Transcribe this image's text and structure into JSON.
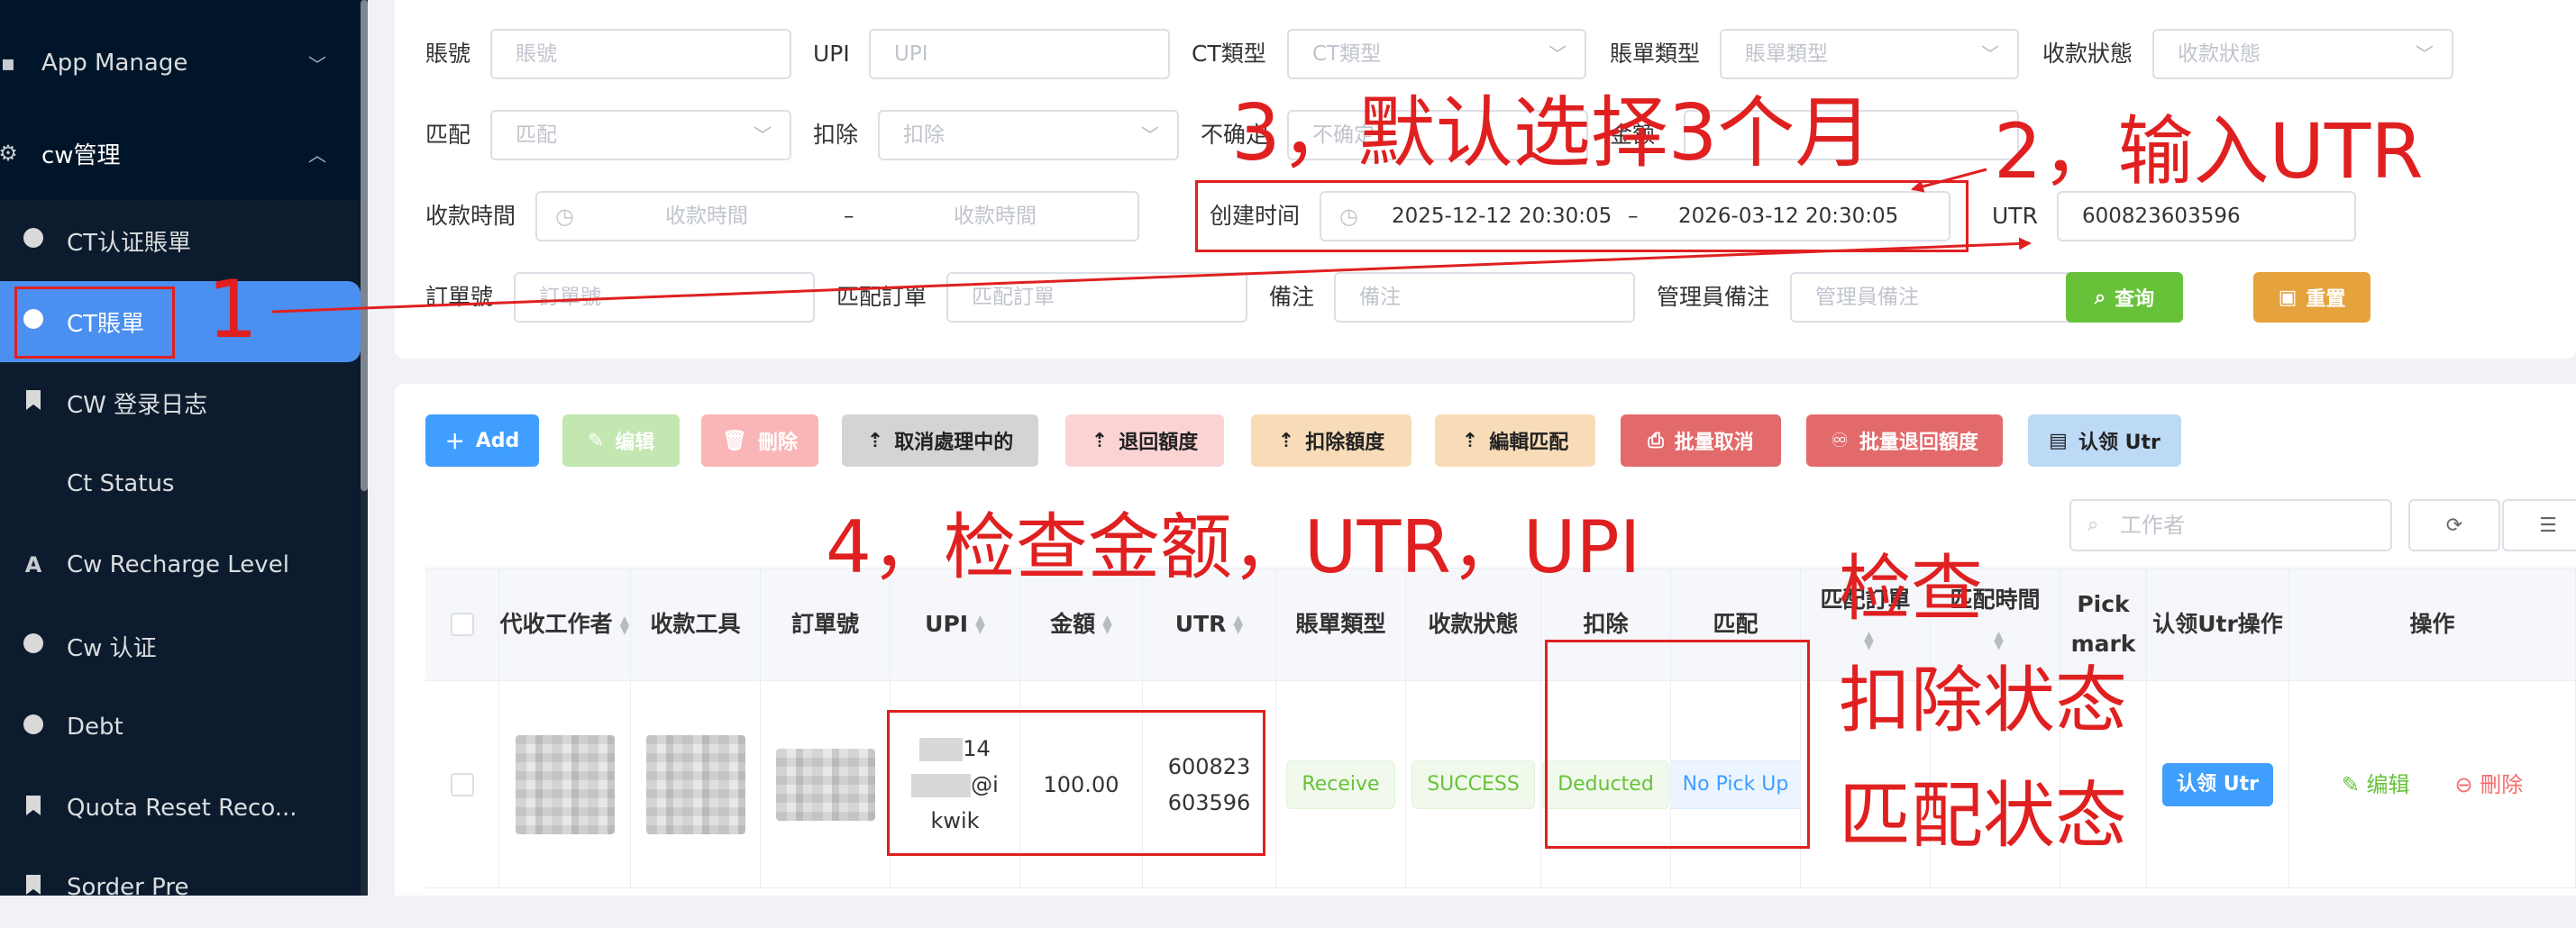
{
  "sidebar": {
    "items": [
      {
        "label": "App Manage",
        "icon": "app-icon"
      },
      {
        "label": "cw管理",
        "icon": "gear-icon"
      },
      {
        "label": "CT认证賬單",
        "icon": "dot-icon"
      },
      {
        "label": "CT賬單",
        "icon": "dot-icon"
      },
      {
        "label": "CW 登录日志",
        "icon": "bookmark-icon"
      },
      {
        "label": "Ct Status",
        "icon": ""
      },
      {
        "label": "Cw Recharge Level",
        "icon": "font-icon"
      },
      {
        "label": "Cw 认证",
        "icon": "dot-icon"
      },
      {
        "label": "Debt",
        "icon": "dot-icon"
      },
      {
        "label": "Quota Reset Reco...",
        "icon": "bookmark-icon"
      },
      {
        "label": "Sorder Pre",
        "icon": "bookmark-icon"
      }
    ]
  },
  "filters": {
    "account": {
      "label": "賬號",
      "placeholder": "賬號"
    },
    "upi": {
      "label": "UPI",
      "placeholder": "UPI"
    },
    "ct_type": {
      "label": "CT類型",
      "placeholder": "CT類型"
    },
    "bill_type": {
      "label": "賬單類型",
      "placeholder": "賬單類型"
    },
    "pay_status": {
      "label": "收款狀態",
      "placeholder": "收款狀態"
    },
    "match": {
      "label": "匹配",
      "placeholder": "匹配"
    },
    "deduct": {
      "label": "扣除",
      "placeholder": "扣除"
    },
    "uncertain": {
      "label": "不确定",
      "placeholder": "不确定"
    },
    "amount": {
      "label": "金额"
    },
    "pay_time": {
      "label": "收款時間",
      "start_placeholder": "收款時間",
      "end_placeholder": "收款時間",
      "sep": "–"
    },
    "create_time": {
      "label": "创建时间",
      "start": "2025-12-12 20:30:05",
      "end": "2026-03-12 20:30:05",
      "sep": "–"
    },
    "utr": {
      "label": "UTR",
      "value": "600823603596"
    },
    "order_no": {
      "label": "訂單號",
      "placeholder": "訂單號"
    },
    "match_order": {
      "label": "匹配訂單",
      "placeholder": "匹配訂單"
    },
    "remark": {
      "label": "備注",
      "placeholder": "備注"
    },
    "admin_remark": {
      "label": "管理員備注",
      "placeholder": "管理員備注"
    },
    "query_label": "查询",
    "reset_label": "重置"
  },
  "toolbar": {
    "add": "Add",
    "edit": "编辑",
    "delete": "刪除",
    "cancel_processing": "取消處理中的",
    "return_quota": "退回額度",
    "deduct_quota": "扣除額度",
    "edit_match": "編輯匹配",
    "batch_cancel": "批量取消",
    "batch_return_quota": "批量退回額度",
    "claim_utr": "认领 Utr",
    "search_worker_placeholder": "工作者"
  },
  "table": {
    "headers": {
      "worker": "代收工作者",
      "tool": "收款工具",
      "order_no": "訂單號",
      "upi": "UPI",
      "amount": "金額",
      "utr": "UTR",
      "bill_type": "賬單類型",
      "pay_status": "收款狀態",
      "deduct": "扣除",
      "match": "匹配",
      "match_order": "匹配訂單",
      "match_time": "匹配時間",
      "pick_mark": "Pick mark",
      "claim_op": "认领Utr操作",
      "actions": "操作"
    },
    "row": {
      "upi_line1": "14",
      "upi_line2": "@i",
      "upi_line3": "kwik",
      "amount": "100.00",
      "utr_line1": "600823",
      "utr_line2": "603596",
      "bill_type": "Receive",
      "pay_status": "SUCCESS",
      "deduct": "Deducted",
      "match": "No Pick Up",
      "claim_btn": "认领 Utr",
      "edit": "编辑",
      "delete": "刪除"
    }
  },
  "annotations": {
    "step1": "1",
    "step2": "2，输入UTR",
    "step3": "3，默认选择3个月",
    "step4": "4，检查金额，UTR，UPI",
    "check_title": "检查",
    "check_deduct": "扣除状态",
    "check_match": "匹配状态"
  },
  "colors": {
    "sidebar_bg": "#001529",
    "active_item": "#4b8ff0",
    "annotation_red": "#e02020",
    "query_green": "#67c23a",
    "reset_orange": "#e6a23c",
    "primary_blue": "#409eff"
  }
}
